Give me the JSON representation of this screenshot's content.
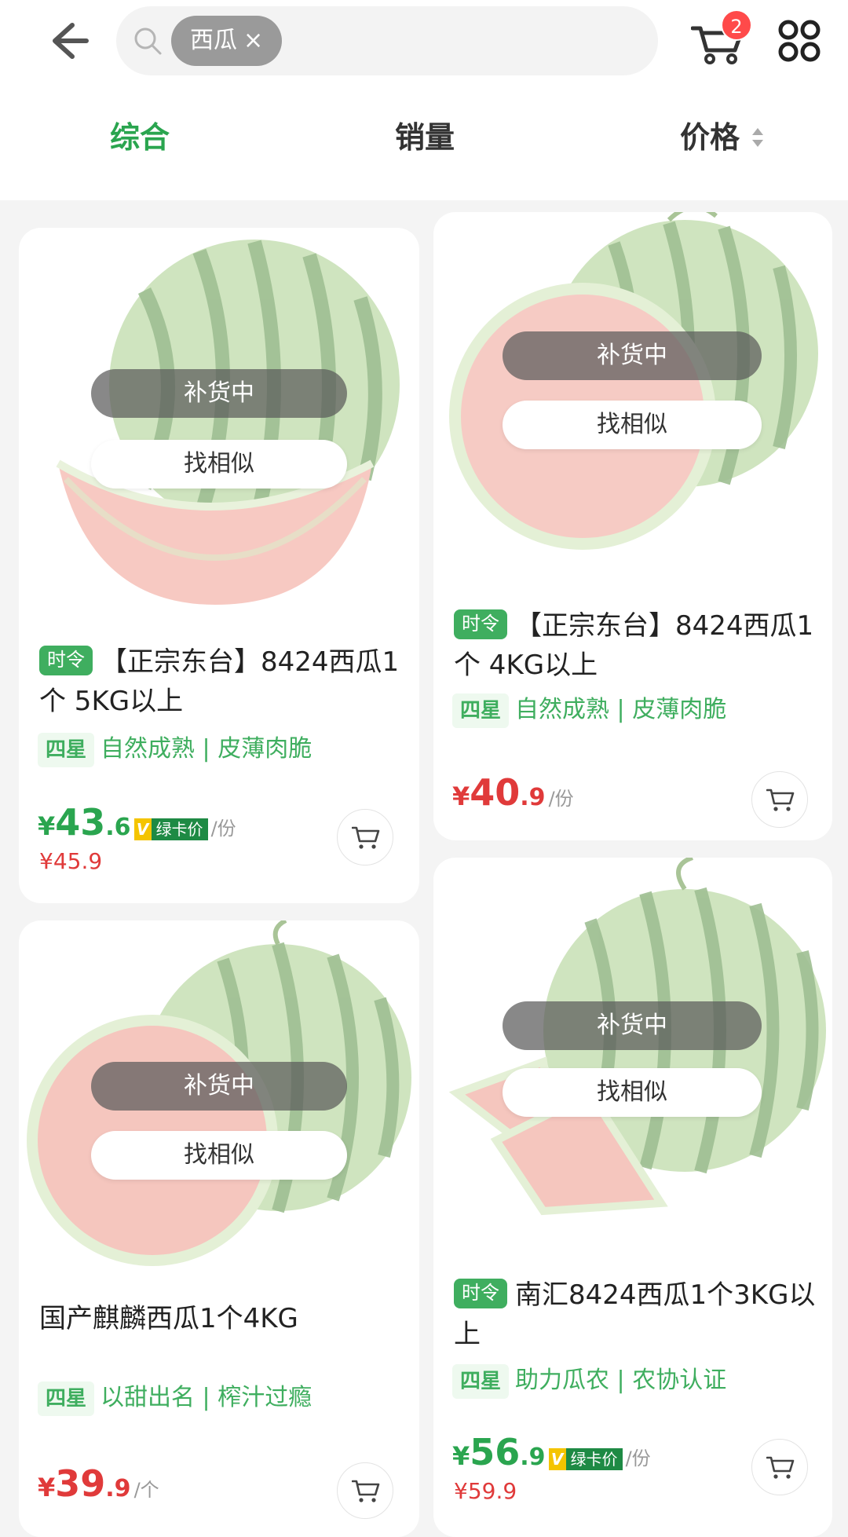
{
  "search": {
    "chip": "西瓜",
    "chip_close": "×"
  },
  "cart": {
    "badge": "2"
  },
  "tabs": {
    "t1": "综合",
    "t2": "销量",
    "t3": "价格"
  },
  "overlay": {
    "restock": "补货中",
    "similar": "找相似"
  },
  "products": [
    {
      "season_tag": "时令",
      "title": "【正宗东台】8424西瓜1个 5KG以上",
      "stars": "四星",
      "features": "自然成熟 | 皮薄肉脆",
      "yen": "¥",
      "price_int": "43",
      "price_dec": ".6",
      "card_v": "V",
      "card_label": "绿卡价",
      "unit": "/份",
      "orig_price": "¥45.9"
    },
    {
      "season_tag": "时令",
      "title": "【正宗东台】8424西瓜1个 4KG以上",
      "stars": "四星",
      "features": "自然成熟 | 皮薄肉脆",
      "yen": "¥",
      "price_int": "40",
      "price_dec": ".9",
      "unit": "/份"
    },
    {
      "title": "国产麒麟西瓜1个4KG",
      "stars": "四星",
      "features": "以甜出名 | 榨汁过瘾",
      "yen": "¥",
      "price_int": "39",
      "price_dec": ".9",
      "unit": "/个"
    },
    {
      "season_tag": "时令",
      "title": "南汇8424西瓜1个3KG以上",
      "stars": "四星",
      "features": "助力瓜农 | 农协认证",
      "yen": "¥",
      "price_int": "56",
      "price_dec": ".9",
      "card_v": "V",
      "card_label": "绿卡价",
      "unit": "/份",
      "orig_price": "¥59.9"
    }
  ],
  "colors": {
    "accent_green": "#2aa54f",
    "price_red": "#e03a3a",
    "badge_red": "#ff4a4a"
  },
  "icons": [
    "back-arrow-icon",
    "search-icon",
    "cart-icon",
    "grid-menu-icon",
    "sort-arrows-icon",
    "add-to-cart-icon"
  ]
}
